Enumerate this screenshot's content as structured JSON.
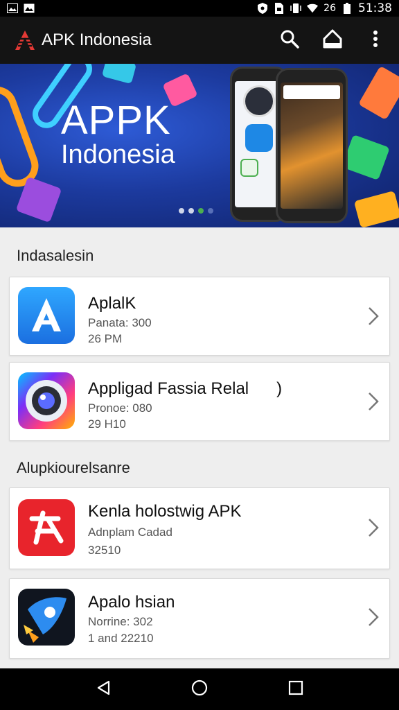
{
  "status_bar": {
    "battery_text": "26",
    "time": "51:38"
  },
  "app_bar": {
    "title": "APK Indonesia",
    "icons": [
      "apk-logo-icon",
      "search-icon",
      "home-icon",
      "more-vert-icon"
    ]
  },
  "banner": {
    "title": "APPK",
    "subtitle": "Indonesia",
    "carousel_pages": 4,
    "carousel_active_index": 2
  },
  "sections": [
    {
      "title": "Indasalesin",
      "items": [
        {
          "title": "AplalK",
          "line1": "Panata: 300",
          "line2": "26 PM",
          "icon": "app-store-a-icon"
        },
        {
          "title": "Appligad Fassia Relal      )",
          "line1": "Pronoe: 080",
          "line2": "29 H10",
          "icon": "camera-lens-icon"
        }
      ]
    },
    {
      "title": "Alupkiourelsanre",
      "items": [
        {
          "title": "Kenla holostwig APK",
          "line1": "Adnplam Cadad",
          "line2": "32510",
          "icon": "red-apk-logo-icon"
        },
        {
          "title": "Apalo hsian",
          "line1": "Norrine: 302",
          "line2": "1 and 22210",
          "icon": "rocket-phone-icon"
        }
      ]
    }
  ],
  "colors": {
    "app_bar": "#141414",
    "banner_blue": "#1c3a9e",
    "accent_green": "#4caf50",
    "card_bg": "#ffffff",
    "page_bg": "#eeeeee"
  },
  "nav_bar": {
    "icons": [
      "back-icon",
      "home-circle-icon",
      "recents-icon"
    ]
  }
}
